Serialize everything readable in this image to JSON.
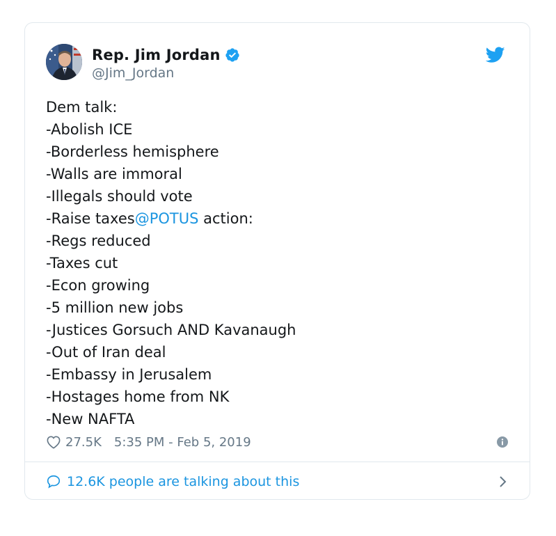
{
  "author": {
    "display_name": "Rep. Jim Jordan",
    "handle": "@Jim_Jordan",
    "verified": true
  },
  "tweet": {
    "lines": [
      {
        "text": "Dem talk:"
      },
      {
        "text": "-Abolish ICE"
      },
      {
        "text": "-Borderless hemisphere"
      },
      {
        "text": "-Walls are immoral"
      },
      {
        "text": "-Illegals should vote"
      },
      {
        "text": "-Raise taxes",
        "mention": "@POTUS",
        "after": " action:"
      },
      {
        "text": "-Regs reduced"
      },
      {
        "text": "-Taxes cut"
      },
      {
        "text": "-Econ growing"
      },
      {
        "text": "-5 million new jobs"
      },
      {
        "text": "-Justices Gorsuch AND Kavanaugh"
      },
      {
        "text": "-Out of Iran deal"
      },
      {
        "text": "-Embassy in Jerusalem"
      },
      {
        "text": "-Hostages home from NK"
      },
      {
        "text": "-New NAFTA"
      }
    ]
  },
  "meta": {
    "likes": "27.5K",
    "timestamp": "5:35 PM - Feb 5, 2019"
  },
  "footer": {
    "talking": "12.6K people are talking about this"
  },
  "icons": {
    "verified": "verified-badge-icon",
    "brand": "twitter-bird-icon",
    "like": "heart-icon",
    "info": "info-icon",
    "reply": "speech-bubble-icon",
    "chevron": "chevron-right-icon"
  },
  "colors": {
    "brand": "#1da1f2",
    "link": "#1b95e0",
    "text": "#14171a",
    "secondary": "#657786",
    "border": "#e1e8ed"
  }
}
